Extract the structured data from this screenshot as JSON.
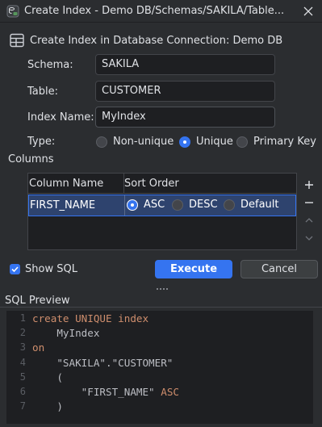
{
  "window": {
    "title": "Create Index - Demo DB/Schemas/SAKILA/Table..."
  },
  "header": {
    "text": "Create Index in Database Connection: Demo DB"
  },
  "form": {
    "schema_label": "Schema:",
    "schema_value": "SAKILA",
    "table_label": "Table:",
    "table_value": "CUSTOMER",
    "index_name_label": "Index Name:",
    "index_name_value": "MyIndex",
    "type_label": "Type:",
    "type_options": [
      {
        "label": "Non-unique",
        "selected": false
      },
      {
        "label": "Unique",
        "selected": true
      },
      {
        "label": "Primary Key",
        "selected": false
      }
    ]
  },
  "columns": {
    "section_label": "Columns",
    "headers": [
      "Column Name",
      "Sort Order"
    ],
    "rows": [
      {
        "column_name": "FIRST_NAME",
        "sort_options": [
          {
            "label": "ASC",
            "selected": true
          },
          {
            "label": "DESC",
            "selected": false
          },
          {
            "label": "Default",
            "selected": false
          }
        ]
      }
    ],
    "tools": [
      "plus-icon",
      "minus-icon",
      "chevron-up-icon",
      "chevron-down-icon"
    ]
  },
  "footer": {
    "show_sql_label": "Show SQL",
    "show_sql_checked": true,
    "execute_label": "Execute",
    "cancel_label": "Cancel"
  },
  "sql_preview": {
    "label": "SQL Preview",
    "line_numbers": [
      "1",
      "2",
      "3",
      "4",
      "5",
      "6",
      "7"
    ],
    "lines": [
      [
        {
          "t": "create UNIQUE index",
          "k": true
        }
      ],
      [
        {
          "t": "    MyIndex",
          "k": false
        }
      ],
      [
        {
          "t": "on",
          "k": true
        }
      ],
      [
        {
          "t": "    \"SAKILA\".\"CUSTOMER\"",
          "k": false
        }
      ],
      [
        {
          "t": "    (",
          "k": false
        }
      ],
      [
        {
          "t": "        \"FIRST_NAME\" ",
          "k": false
        },
        {
          "t": "ASC",
          "k": true
        }
      ],
      [
        {
          "t": "    )",
          "k": false
        }
      ]
    ]
  },
  "colors": {
    "accent": "#3574f0",
    "background": "#2b2d30",
    "editor_background": "#1e1f22",
    "keyword": "#cf8e6d",
    "selected_row": "#2e436e"
  }
}
